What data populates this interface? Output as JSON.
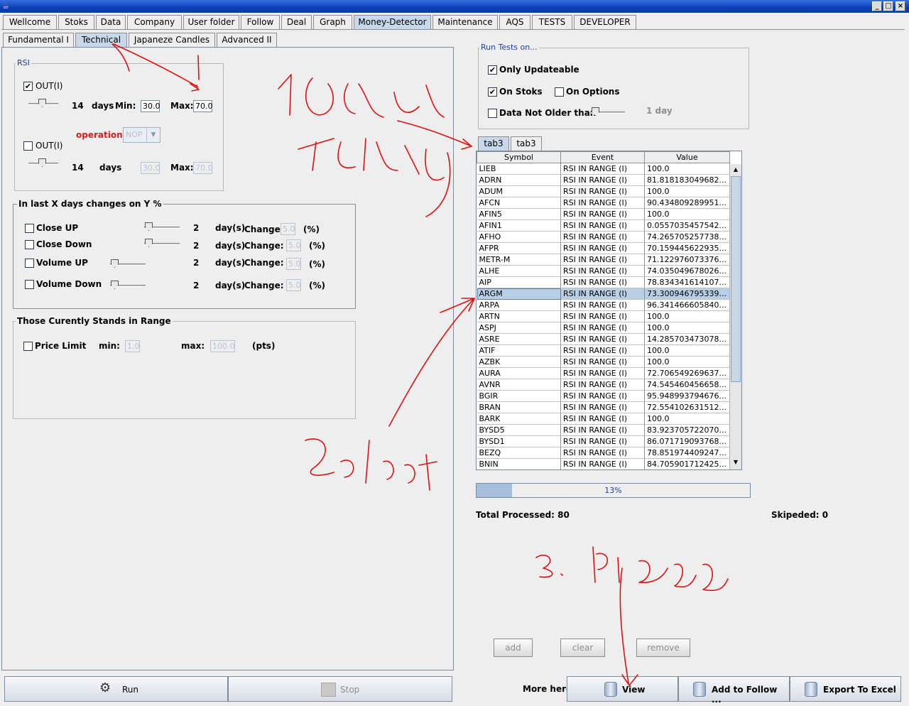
{
  "window": {
    "minimize": "_",
    "maximize": "□",
    "close": "×"
  },
  "main_tabs": [
    "Wellcome",
    "Stoks",
    "Data",
    "Company",
    "User folder",
    "Follow",
    "Deal",
    "Graph",
    "Money-Detector",
    "Maintenance",
    "AQS",
    "TESTS",
    "DEVELOPER"
  ],
  "sub_tabs": [
    "Fundamental I",
    "Technical",
    "Japaneze Candles",
    "Advanced II"
  ],
  "rsi": {
    "title": "RSI",
    "out1_label": "OUT(I)",
    "out1_checked": "✔",
    "days1": "14",
    "days_label": "days",
    "min_label": "Min:",
    "min1": "30.0",
    "max_label": "Max:",
    "max1": "70.0",
    "operation_label": "operation",
    "operation_value": "NOP",
    "out2_label": "OUT(I)",
    "days2": "14",
    "min2": "30.0",
    "max2": "70.0"
  },
  "lastx": {
    "title": "In last X days changes on Y %",
    "rows": [
      {
        "label": "Close UP",
        "days": "2",
        "unit": "day(s)",
        "change_label": "Change:",
        "change": "5.0",
        "pct": "(%)"
      },
      {
        "label": "Close Down",
        "days": "2",
        "unit": "day(s)",
        "change_label": "Change:",
        "change": "5.0",
        "pct": "(%)"
      },
      {
        "label": "Volume UP",
        "days": "2",
        "unit": "day(s)",
        "change_label": "Change:",
        "change": "5.0",
        "pct": "(%)"
      },
      {
        "label": "Volume Down",
        "days": "2",
        "unit": "day(s)",
        "change_label": "Change:",
        "change": "5.0",
        "pct": "(%)"
      }
    ]
  },
  "range": {
    "title": "Those Curently Stands in Range",
    "price_limit": "Price Limit",
    "min_label": "min:",
    "min": "1.0",
    "max_label": "max:",
    "max": "100.0",
    "unit": "(pts)"
  },
  "run_tests": {
    "title": "Run Tests on...",
    "only_updateable": "Only Updateable",
    "check": "✔",
    "on_stoks": "On Stoks",
    "on_options": "On Options",
    "data_not_older": "Data Not Older than",
    "days_value": "1 day"
  },
  "result_tabs": [
    "tab3",
    "tab3"
  ],
  "table": {
    "headers": [
      "Symbol",
      "Event",
      "Value"
    ],
    "rows": [
      [
        "LIEB",
        "RSI IN RANGE (I)",
        "100.0"
      ],
      [
        "ADRN",
        "RSI IN RANGE (I)",
        "81.818183049682..."
      ],
      [
        "ADUM",
        "RSI IN RANGE (I)",
        "100.0"
      ],
      [
        "AFCN",
        "RSI IN RANGE (I)",
        "90.434809289951..."
      ],
      [
        "AFIN5",
        "RSI IN RANGE (I)",
        "100.0"
      ],
      [
        "AFIN1",
        "RSI IN RANGE (I)",
        "0.0557035457542..."
      ],
      [
        "AFHO",
        "RSI IN RANGE (I)",
        "74.265705257738..."
      ],
      [
        "AFPR",
        "RSI IN RANGE (I)",
        "70.159445622935..."
      ],
      [
        "METR-M",
        "RSI IN RANGE (I)",
        "71.122976073376..."
      ],
      [
        "ALHE",
        "RSI IN RANGE (I)",
        "74.035049678026..."
      ],
      [
        "AIP",
        "RSI IN RANGE (I)",
        "78.834341614107..."
      ],
      [
        "ARGM",
        "RSI IN RANGE (I)",
        "73.300946795339..."
      ],
      [
        "ARPA",
        "RSI IN RANGE (I)",
        "96.341466605840..."
      ],
      [
        "ARTN",
        "RSI IN RANGE (I)",
        "100.0"
      ],
      [
        "ASPJ",
        "RSI IN RANGE (I)",
        "100.0"
      ],
      [
        "ASRE",
        "RSI IN RANGE (I)",
        "14.285703473078..."
      ],
      [
        "ATIF",
        "RSI IN RANGE (I)",
        "100.0"
      ],
      [
        "AZBK",
        "RSI IN RANGE (I)",
        "100.0"
      ],
      [
        "AURA",
        "RSI IN RANGE (I)",
        "72.706549269637..."
      ],
      [
        "AVNR",
        "RSI IN RANGE (I)",
        "74.545460456658..."
      ],
      [
        "BGIR",
        "RSI IN RANGE (I)",
        "95.948993794676..."
      ],
      [
        "BRAN",
        "RSI IN RANGE (I)",
        "72.554102631512..."
      ],
      [
        "BARK",
        "RSI IN RANGE (I)",
        "100.0"
      ],
      [
        "BYSD5",
        "RSI IN RANGE (I)",
        "83.923705722070..."
      ],
      [
        "BYSD1",
        "RSI IN RANGE (I)",
        "86.071719093768..."
      ],
      [
        "BEZQ",
        "RSI IN RANGE (I)",
        "78.851974409247..."
      ],
      [
        "BNIN",
        "RSI IN RANGE (I)",
        "84.705901712425..."
      ]
    ],
    "selected_index": 11
  },
  "progress": {
    "label": "13%",
    "fraction": 0.13
  },
  "totals": {
    "processed": "Total Processed: 80",
    "skipped": "Skipeded: 0"
  },
  "list_buttons": {
    "add": "add",
    "clear": "clear",
    "remove": "remove"
  },
  "bottom": {
    "run": "Run",
    "stop": "Stop",
    "more_here": "More here:",
    "view": "View",
    "add_follow": "Add to Follow ...",
    "export": "Export To Excel"
  },
  "colors": {
    "selected_tab": "#c7d8ea",
    "selected_row": "#b8cfe5",
    "progress_fill": "#a7bed9",
    "operation_label": "#cc2222",
    "annotation": "#e01010"
  }
}
